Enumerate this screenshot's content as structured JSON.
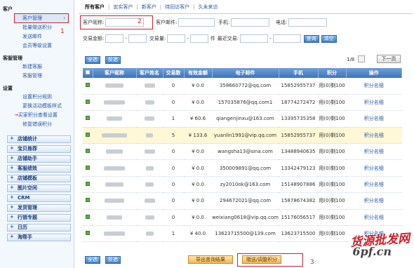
{
  "sidebar": {
    "customer_title": "客户",
    "customer_items": [
      {
        "label": "客户管理"
      },
      {
        "label": "批量赠送积分"
      },
      {
        "label": "发送邮件"
      },
      {
        "label": "会员等级设置"
      }
    ],
    "annotation_1": "1",
    "service_title": "客服管理",
    "service_items": [
      {
        "label": "新建客服"
      },
      {
        "label": "客服管理"
      }
    ],
    "settings_title": "设置",
    "settings_items": [
      {
        "label": "设置积分规则"
      },
      {
        "label": "更换活动模板样式"
      },
      {
        "label": "买家积分查看设置"
      },
      {
        "label": "修复错误积分"
      }
    ],
    "categories": [
      {
        "label": "店铺统计"
      },
      {
        "label": "宝贝推荐"
      },
      {
        "label": "店铺助手"
      },
      {
        "label": "客服绩效"
      },
      {
        "label": "店铺模板"
      },
      {
        "label": "图片空间"
      },
      {
        "label": "CRM"
      },
      {
        "label": "发货管理"
      },
      {
        "label": "行销专题"
      },
      {
        "label": "日历"
      },
      {
        "label": "淘帮手"
      }
    ]
  },
  "tabs": [
    {
      "label": "所有客户"
    },
    {
      "label": "忠实客户"
    },
    {
      "label": "新客户"
    },
    {
      "label": "待回访客户"
    },
    {
      "label": "久未来访"
    }
  ],
  "filters": {
    "nickname_label": "客户昵称:",
    "annotation_2": "2",
    "email_label": "客户邮件:",
    "mobile_label": "手机:",
    "phone_label": "电话:",
    "amount_label": "交易金额:",
    "count_label": "交易量:",
    "count_unit": "件",
    "recent_label": "最近交易:",
    "query_label": "查询",
    "clear_label": "清空"
  },
  "toolbar": {
    "select_all": "全选",
    "invert": "反选",
    "page_info": "1/8",
    "next_page": "下一页"
  },
  "table": {
    "headers": [
      "全",
      "客户昵称",
      "客户姓名",
      "交易数",
      "有效金额",
      "电子邮件",
      "手机",
      "积分",
      "操作"
    ],
    "rows": [
      {
        "count": "0",
        "amount": "¥ 0.0",
        "email": "358660772@qq.com",
        "mobile": "15852955737",
        "points": "用(0)剩100",
        "op": "积分名细",
        "hl": false
      },
      {
        "count": "0",
        "amount": "¥ 0.0",
        "email": "157035876@qq.com1",
        "mobile": "18774272472",
        "points": "用(0)剩100",
        "op": "积分名细",
        "hl": false
      },
      {
        "count": "1",
        "amount": "¥ 60.6",
        "email": "qiangenjinxu@163.com",
        "mobile": "13395735358",
        "points": "用(0)剩100",
        "op": "积分名细",
        "hl": false
      },
      {
        "count": "5",
        "amount": "¥ 133.6",
        "email": "yuanlin1991@vip.qq.com",
        "mobile": "15852955737",
        "points": "用(0)剩100",
        "op": "积分名细",
        "hl": true
      },
      {
        "count": "0",
        "amount": "¥ 0.0",
        "email": "wangsha13@sina.com",
        "mobile": "13488940635",
        "points": "用(0)剩100",
        "op": "积分名细",
        "hl": false
      },
      {
        "count": "0",
        "amount": "¥ 0.0",
        "email": "350009891@qq.com",
        "mobile": "13342479123",
        "points": "用(0)剩100",
        "op": "积分名细",
        "hl": false
      },
      {
        "count": "0",
        "amount": "¥ 0.0",
        "email": "zy2010ok@163.com",
        "mobile": "15148907886",
        "points": "用(0)剩100",
        "op": "积分名细",
        "hl": false
      },
      {
        "count": "0",
        "amount": "¥ 0.0",
        "email": "294672021@qq.com",
        "mobile": "15878674382",
        "points": "用(0)剩100",
        "op": "积分名细",
        "hl": false
      },
      {
        "count": "0",
        "amount": "¥ 0.0",
        "email": "weixiang0618@vip.qq.com",
        "mobile": "15176056517",
        "points": "用(0)剩100",
        "op": "积分名细",
        "hl": false
      },
      {
        "count": "1",
        "amount": "¥ 40.0",
        "email": "13623715500@139.com",
        "mobile": "13623715500",
        "points": "用(0)剩100",
        "op": "积分名细",
        "hl": false
      }
    ]
  },
  "bottom": {
    "select_all": "全选",
    "invert": "反选",
    "export": "导出查询结果",
    "gift_points": "赠送/调整积分",
    "annotation_3": "3"
  },
  "watermark": {
    "line1": "货源批发网",
    "line2": "6pf.cn"
  }
}
